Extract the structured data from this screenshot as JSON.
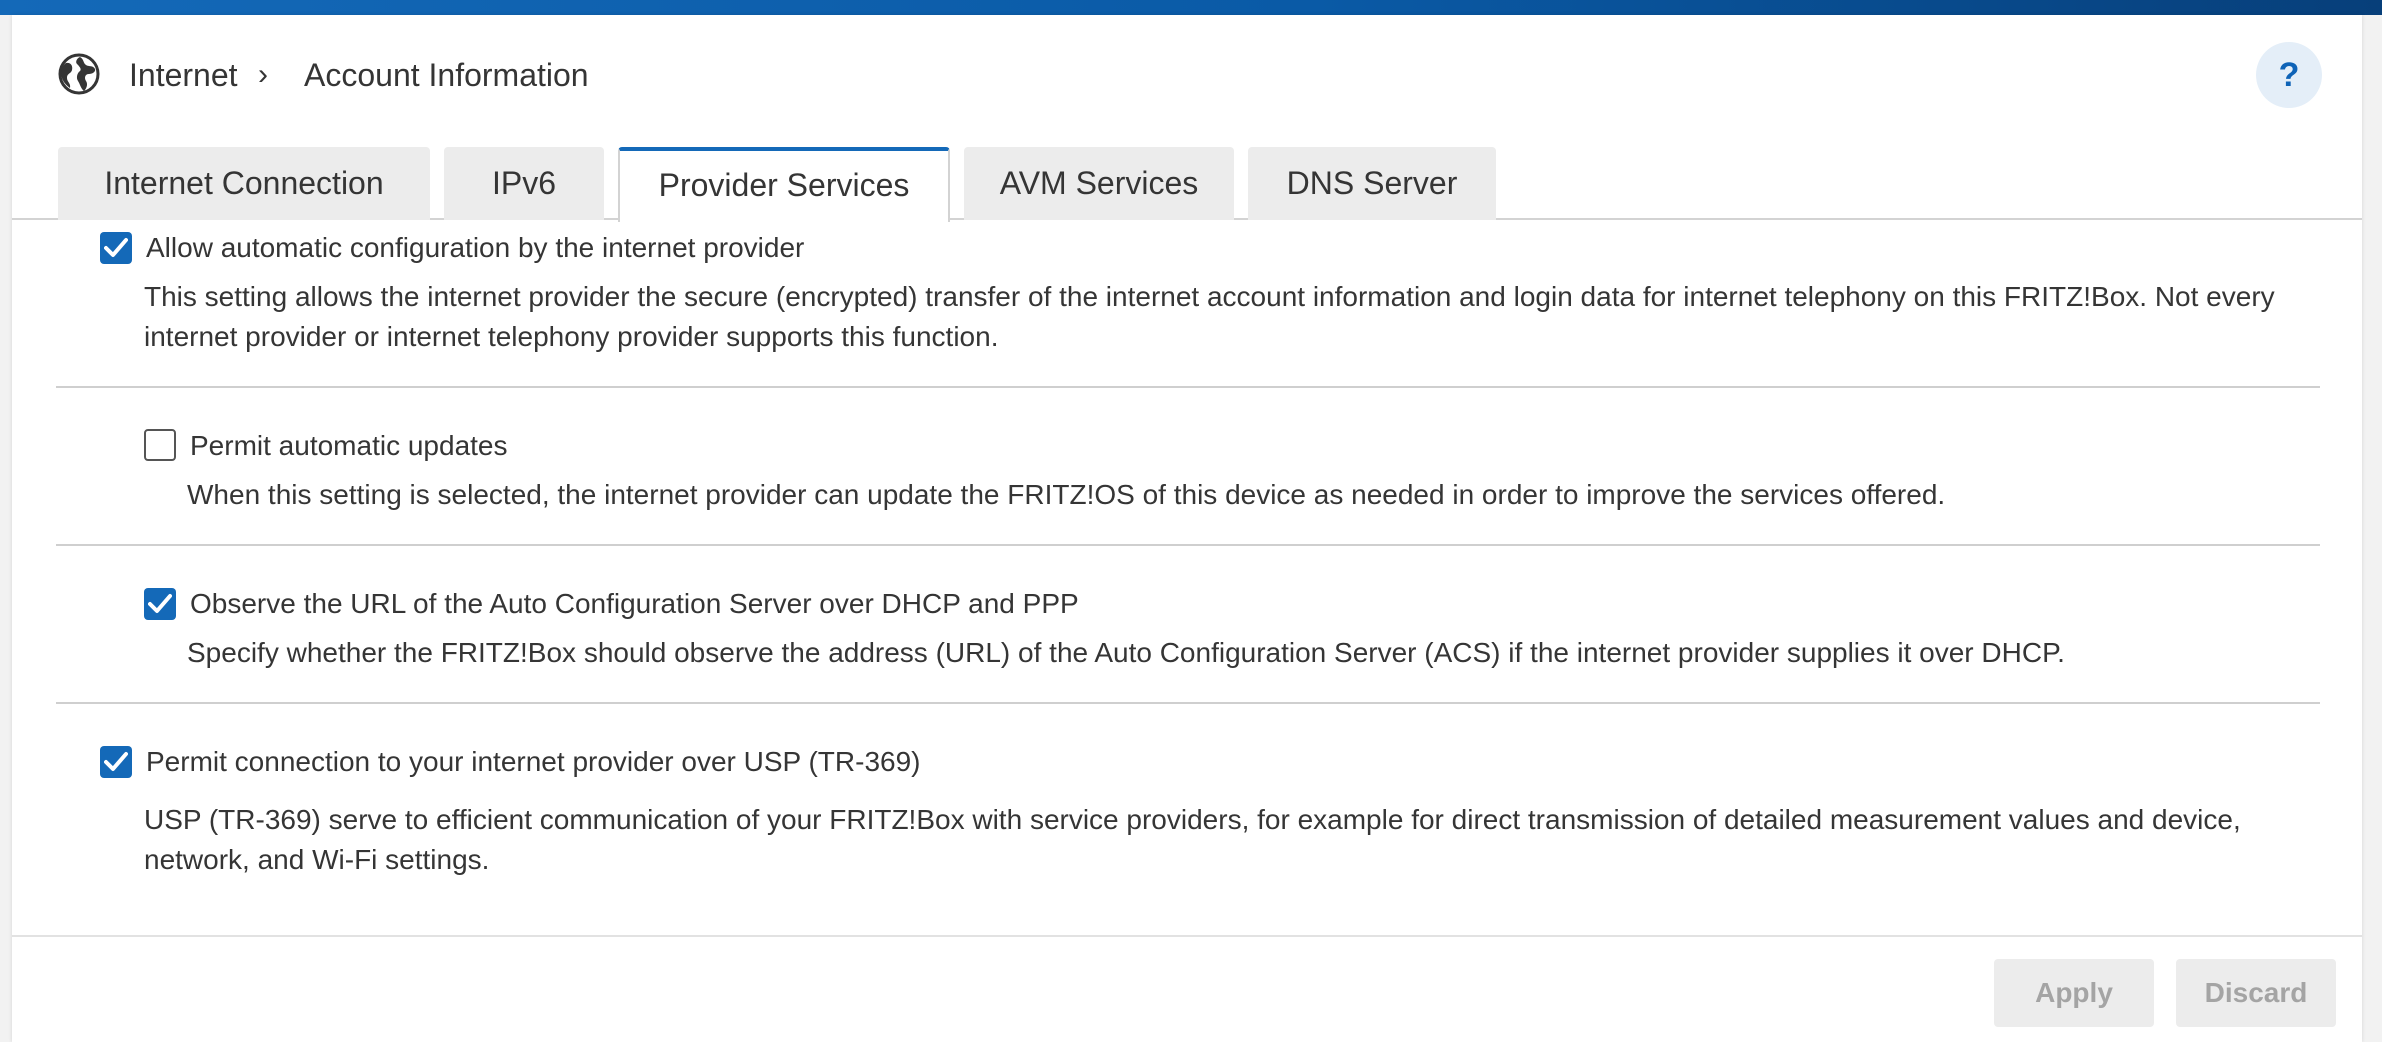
{
  "breadcrumb": {
    "section": "Internet",
    "separator": "›",
    "page": "Account Information"
  },
  "help": {
    "label": "?"
  },
  "icons": {
    "globe": "globe-icon",
    "separator": "chevron-right-icon",
    "check": "check-icon"
  },
  "colors": {
    "accent": "#1469b8",
    "topbar": "#0a5aa6",
    "help_bg": "#e4eef8",
    "button_disabled_text": "#a4a4a4"
  },
  "tabs": [
    {
      "label": "Internet Connection",
      "active": false
    },
    {
      "label": "IPv6",
      "active": false
    },
    {
      "label": "Provider Services",
      "active": true
    },
    {
      "label": "AVM Services",
      "active": false
    },
    {
      "label": "DNS Server",
      "active": false
    }
  ],
  "settings": [
    {
      "label": "Allow automatic configuration by the internet provider",
      "checked": true,
      "description": "This setting allows the internet provider the secure (encrypted) transfer of the internet account information and login data for internet telephony on this FRITZ!Box. Not every internet provider or internet telephony provider supports this function."
    },
    {
      "label": "Permit automatic updates",
      "checked": false,
      "description": "When this setting is selected, the internet provider can update the FRITZ!OS of this device as needed in order to improve the services offered."
    },
    {
      "label": "Observe the URL of the Auto Configuration Server over DHCP and PPP",
      "checked": true,
      "description": "Specify whether the FRITZ!Box should observe the address (URL) of the Auto Configuration Server (ACS) if the internet provider supplies it over DHCP."
    },
    {
      "label": "Permit connection to your internet provider over USP (TR-369)",
      "checked": true,
      "description": "USP (TR-369) serve to efficient communication of your FRITZ!Box with service providers, for example for direct transmission of detailed measurement values and device, network, and Wi-Fi settings."
    }
  ],
  "footer": {
    "apply_label": "Apply",
    "discard_label": "Discard"
  }
}
